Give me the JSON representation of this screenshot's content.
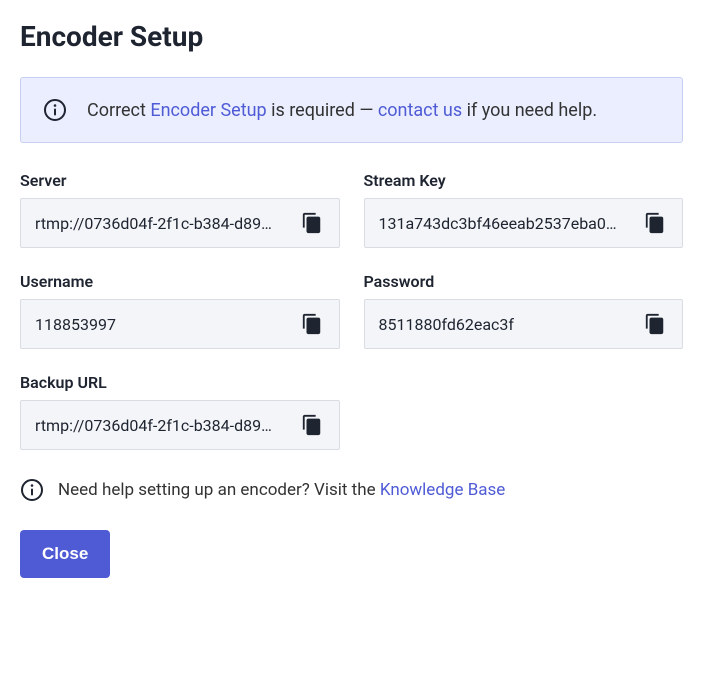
{
  "title": "Encoder Setup",
  "banner": {
    "prefix": "Correct ",
    "link1": "Encoder Setup",
    "mid": " is required — ",
    "link2": "contact us",
    "suffix": " if you need help."
  },
  "fields": {
    "server": {
      "label": "Server",
      "value": "rtmp://0736d04f-2f1c-b384-d89…"
    },
    "stream_key": {
      "label": "Stream Key",
      "value": "131a743dc3bf46eeab2537eba0…"
    },
    "username": {
      "label": "Username",
      "value": "118853997"
    },
    "password": {
      "label": "Password",
      "value": "8511880fd62eac3f"
    },
    "backup_url": {
      "label": "Backup URL",
      "value": "rtmp://0736d04f-2f1c-b384-d89…"
    }
  },
  "help": {
    "prefix": "Need help setting up an encoder? Visit the ",
    "link": "Knowledge Base"
  },
  "close_label": "Close"
}
